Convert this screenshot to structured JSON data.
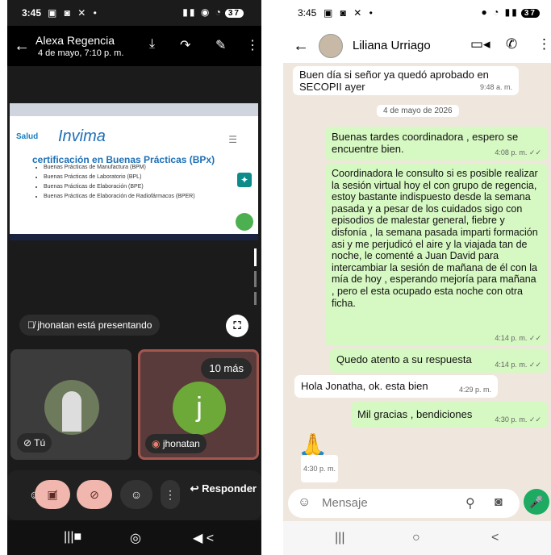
{
  "left_phone": {
    "status_bar": {
      "time": "3:45",
      "battery": "37"
    },
    "header": {
      "contact_name": "Alexa Regencia",
      "date": "4 de mayo, 7:10 p. m."
    },
    "shared_screen": {
      "salud_label": "Salud",
      "logo_text": "Invima",
      "title": "certificación en Buenas Prácticas (BPx)",
      "items": [
        "Buenas Prácticas de Manufactura (BPM)",
        "Buenas Prácticas de Laboratorio (BPL)",
        "Buenas Prácticas de Elaboración (BPE)",
        "Buenas Prácticas de Elaboración de Radiofármacos (BPER)"
      ]
    },
    "presenting_text": "jhonatan está presentando",
    "tile_you_label": "Tú",
    "tile_jhonatan_label": "jhonatan",
    "avatar_initial": "j",
    "more_participants": "10 más",
    "reply_label": "Responder"
  },
  "right_phone": {
    "status_bar": {
      "time": "3:45",
      "battery": "37"
    },
    "header": {
      "contact_name": "Liliana Urriago"
    },
    "date_separator": "4 de mayo de 2026",
    "messages": [
      {
        "text": "Buen día si señor ya quedó aprobado en SECOPII ayer",
        "time": "9:48 a. m."
      },
      {
        "text": "Buenas tardes coordinadora , espero se encuentre bien.",
        "time": "4:08 p. m. ✓✓"
      },
      {
        "text": "Coordinadora le consulto si es posible realizar la sesión virtual hoy el con grupo de regencia,  estoy bastante indispuesto desde la semana pasada y  a pesar de los cuidados sigo con episodios de malestar general,  fiebre y disfonía , la semana pasada imparti formación asi y me perjudicó el aire y la viajada tan de noche,  le comenté a Juan David para intercambiar la sesión de mañana de él con la mía de hoy , esperando mejoría para mañana , pero el esta ocupado esta noche con otra ficha.",
        "time": "4:14 p. m. ✓✓"
      },
      {
        "text": "Quedo atento a su respuesta",
        "time": "4:14 p. m. ✓✓"
      },
      {
        "text": "Hola Jonatha, ok. esta bien",
        "time": "4:29 p. m."
      },
      {
        "text": "Mil gracias , bendiciones",
        "time": "4:30 p. m. ✓✓"
      },
      {
        "text": "🙏",
        "time": "4:30 p. m."
      }
    ],
    "input_placeholder": "Mensaje"
  },
  "colors": {
    "whatsapp_green": "#1daa61",
    "outgoing_bubble": "#d6f8c2",
    "meet_avatar": "#6ca939"
  }
}
